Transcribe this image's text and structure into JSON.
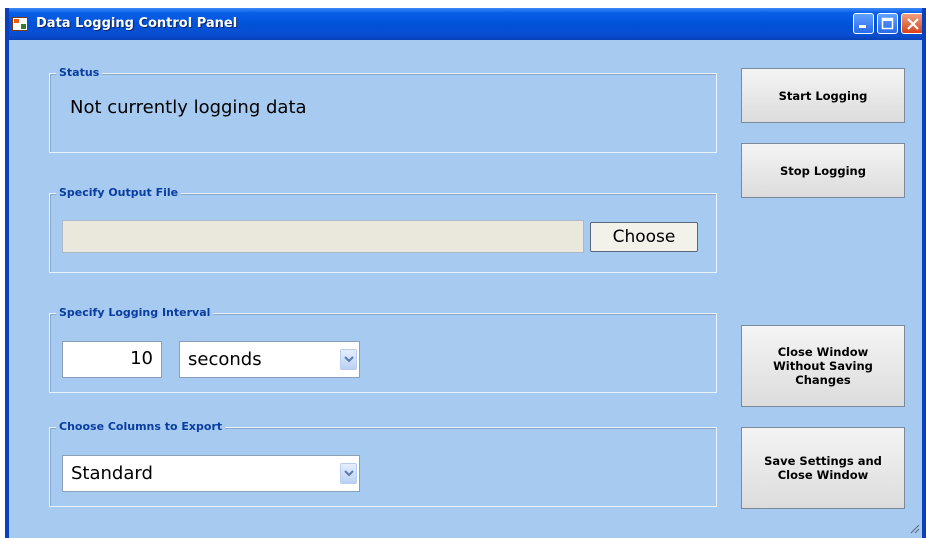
{
  "window": {
    "title": "Data Logging Control Panel",
    "accent_color": "#0a5fe8",
    "background_color": "#a6caf0"
  },
  "titlebar_icons": [
    "app-icon",
    "minimize-icon",
    "maximize-icon",
    "close-icon"
  ],
  "status": {
    "legend": "Status",
    "message": "Not currently logging data"
  },
  "output_file": {
    "legend": "Specify Output File",
    "path_value": "",
    "choose_label": "Choose"
  },
  "interval": {
    "legend": "Specify Logging Interval",
    "value": "10",
    "unit": "seconds"
  },
  "columns": {
    "legend": "Choose Columns to Export",
    "selected": "Standard"
  },
  "buttons": {
    "start_logging": "Start Logging",
    "stop_logging": "Stop Logging",
    "close_without_saving": "Close Window\nWithout Saving\nChanges",
    "save_and_close": "Save Settings and\nClose Window"
  }
}
